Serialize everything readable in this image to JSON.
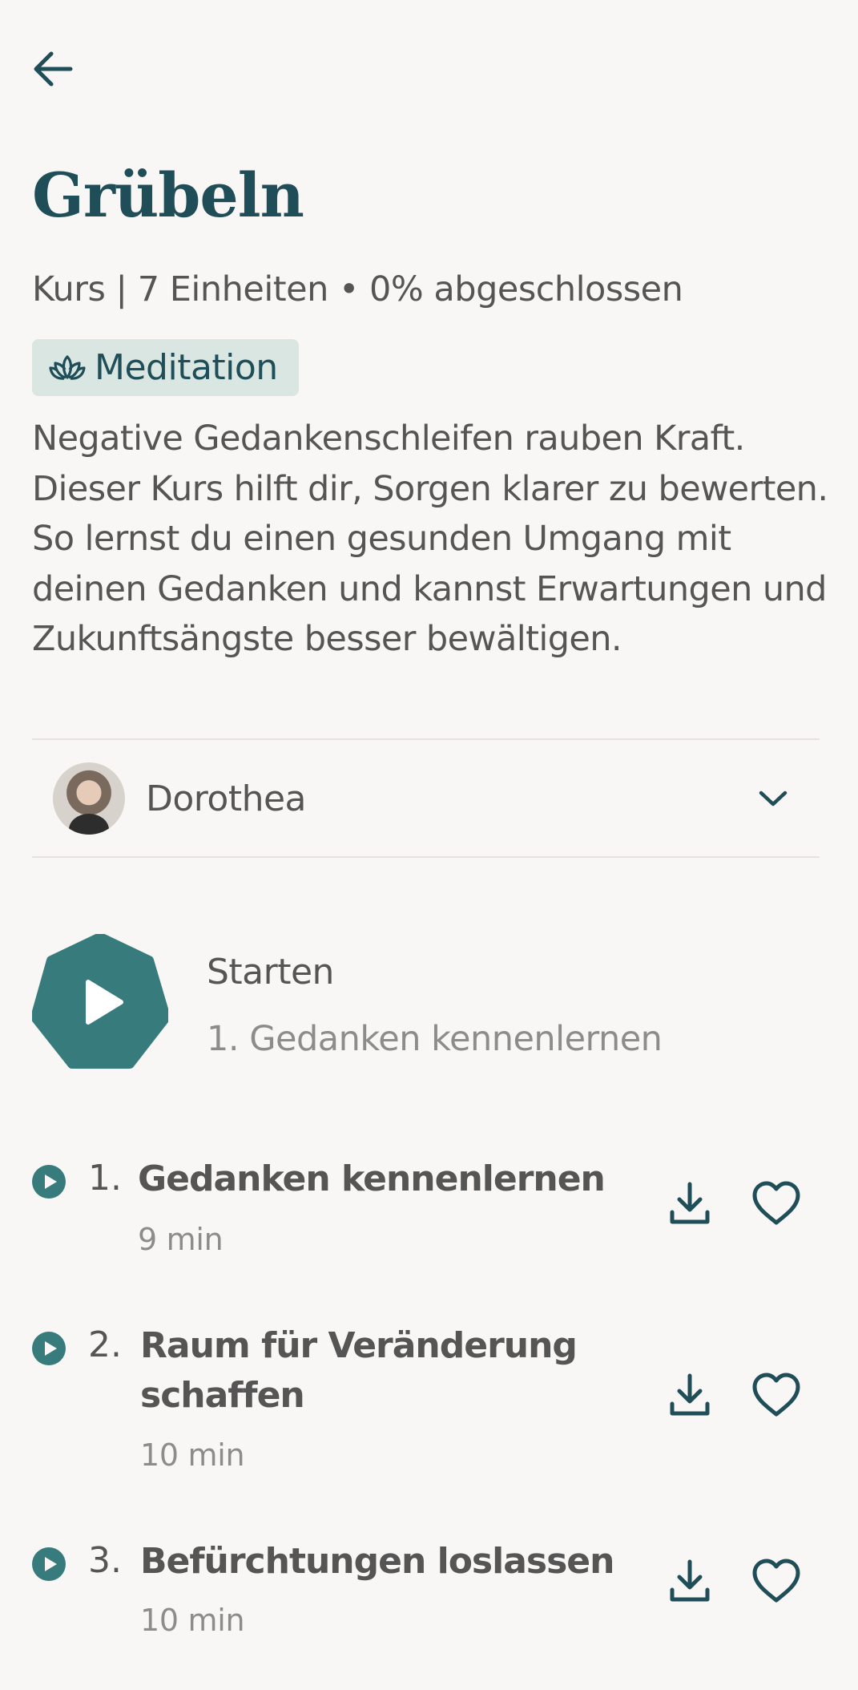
{
  "header": {
    "title": "Grübeln"
  },
  "course": {
    "meta": "Kurs | 7 Einheiten • 0% abgeschlossen",
    "tag_label": "Meditation",
    "description": "Negative Gedankenschleifen rauben Kraft. Dieser Kurs hilft dir, Sorgen klarer zu bewerten. So lernst du einen gesunden Umgang mit deinen Gedanken und kannst Erwartungen und Zukunftsängste besser bewältigen."
  },
  "teacher": {
    "name": "Dorothea"
  },
  "start": {
    "label": "Starten",
    "subtitle": "1. Gedanken kennenlernen"
  },
  "units": [
    {
      "number": "1.",
      "title": "Gedanken kennenlernen",
      "duration": "9 min"
    },
    {
      "number": "2.",
      "title": "Raum für Veränderung schaffen",
      "duration": "10 min"
    },
    {
      "number": "3.",
      "title": "Befürchtungen loslassen",
      "duration": "10 min"
    }
  ],
  "icons": {
    "back": "arrow-left-icon",
    "tag": "lotus-icon",
    "expand": "chevron-down-icon",
    "play": "play-icon",
    "download": "download-icon",
    "favorite": "heart-icon"
  },
  "colors": {
    "primary": "#1f4e58",
    "accent": "#377b7d",
    "tag_bg": "#d9e6e2",
    "background": "#f9f7f5"
  }
}
